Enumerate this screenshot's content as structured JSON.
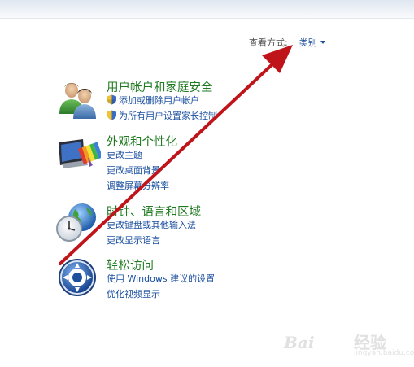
{
  "view_by": {
    "label": "查看方式:",
    "value": "类别"
  },
  "categories": [
    {
      "title": "用户帐户和家庭安全",
      "icon": "users-icon",
      "links": [
        "添加或删除用户帐户",
        "为所有用户设置家长控制"
      ]
    },
    {
      "title": "外观和个性化",
      "icon": "appearance-icon",
      "links": [
        "更改主题",
        "更改桌面背景",
        "调整屏幕分辨率"
      ]
    },
    {
      "title": "时钟、语言和区域",
      "icon": "clock-globe-icon",
      "links": [
        "更改键盘或其他输入法",
        "更改显示语言"
      ]
    },
    {
      "title": "轻松访问",
      "icon": "ease-of-access-icon",
      "links": [
        "使用 Windows 建议的设置",
        "优化视频显示"
      ]
    }
  ],
  "watermark": {
    "logo": "Bai",
    "brand": "经验",
    "site": "jingyan.baidu.com"
  },
  "colors": {
    "title_green": "#1f7a20",
    "link_blue": "#1b4fa0",
    "arrow_red": "#c0141b"
  }
}
